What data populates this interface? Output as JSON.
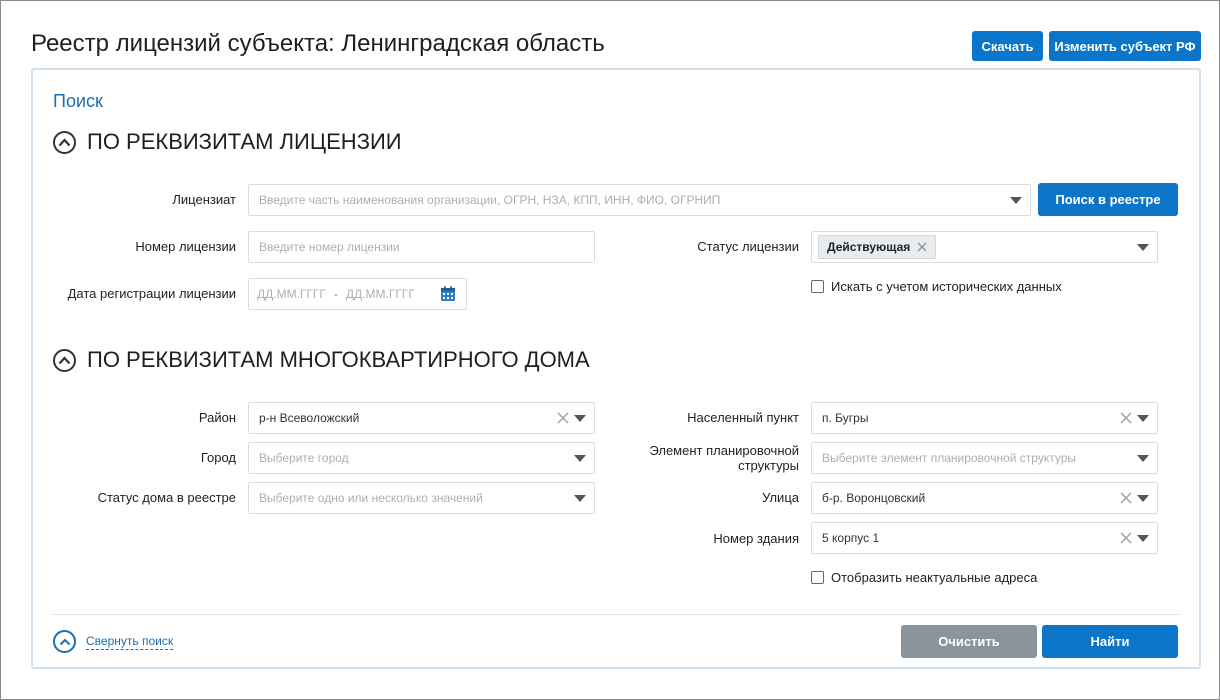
{
  "header": {
    "title": "Реестр лицензий субъекта: Ленинградская область",
    "download_label": "Скачать",
    "change_subject_label": "Изменить субъект РФ"
  },
  "search": {
    "title": "Поиск",
    "collapse_label": "Свернуть поиск",
    "clear_label": "Очистить",
    "find_label": "Найти"
  },
  "license_section": {
    "heading": "ПО РЕКВИЗИТАМ ЛИЦЕНЗИИ",
    "licensee_label": "Лицензиат",
    "licensee_placeholder": "Введите часть наименования организации, ОГРН, НЗА, КПП, ИНН, ФИО, ОГРНИП",
    "registry_search_label": "Поиск в реестре",
    "license_number_label": "Номер лицензии",
    "license_number_placeholder": "Введите номер лицензии",
    "license_status_label": "Статус лицензии",
    "license_status_value": "Действующая",
    "reg_date_label": "Дата регистрации лицензии",
    "date_from_placeholder": "ДД.ММ.ГГГГ",
    "date_separator": "-",
    "date_to_placeholder": "ДД.ММ.ГГГГ",
    "historical_label": "Искать с учетом исторических данных"
  },
  "house_section": {
    "heading": "ПО РЕКВИЗИТАМ МНОГОКВАРТИРНОГО ДОМА",
    "district_label": "Район",
    "district_value": "р-н Всеволожский",
    "city_label": "Город",
    "city_placeholder": "Выберите город",
    "house_status_label": "Статус дома в реестре",
    "house_status_placeholder": "Выберите одно или несколько значений",
    "settlement_label": "Населенный пункт",
    "settlement_value": "п. Бугры",
    "planning_label": "Элемент планировочной структуры",
    "planning_placeholder": "Выберите элемент планировочной структуры",
    "street_label": "Улица",
    "street_value": "б-р. Воронцовский",
    "building_label": "Номер здания",
    "building_value": "5 корпус 1",
    "outdated_label": "Отобразить неактуальные адреса"
  }
}
